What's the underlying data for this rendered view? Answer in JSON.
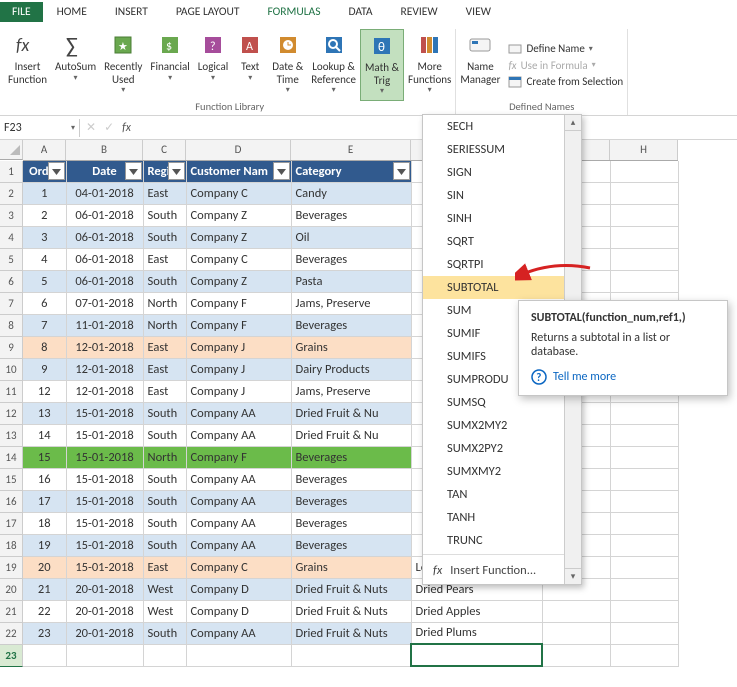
{
  "tabs": {
    "file": "FILE",
    "home": "HOME",
    "insert": "INSERT",
    "page": "PAGE LAYOUT",
    "formulas": "FORMULAS",
    "data": "DATA",
    "review": "REVIEW",
    "view": "VIEW"
  },
  "ribbon": {
    "insert_function": "Insert\nFunction",
    "autosum": "AutoSum",
    "recently": "Recently\nUsed",
    "financial": "Financial",
    "logical": "Logical",
    "text": "Text",
    "datetime": "Date &\nTime",
    "lookup": "Lookup &\nReference",
    "math": "Math &\nTrig",
    "more": "More\nFunctions",
    "group_library": "Function Library",
    "name_mgr": "Name\nManager",
    "def_name": "Define Name",
    "use_formula": "Use in Formula",
    "create_sel": "Create from Selection",
    "group_names": "Defined Names"
  },
  "namebox": "F23",
  "headers": {
    "A": "Order",
    "B": "Date",
    "C": "Regic",
    "D": "Customer Nam",
    "E": "Category"
  },
  "rows": [
    {
      "n": "1",
      "d": "04-01-2018",
      "r": "East",
      "c": "Company C",
      "cat": "Candy",
      "f": "",
      "cls": "band"
    },
    {
      "n": "2",
      "d": "06-01-2018",
      "r": "South",
      "c": "Company Z",
      "cat": "Beverages",
      "f": "",
      "cls": ""
    },
    {
      "n": "3",
      "d": "06-01-2018",
      "r": "South",
      "c": "Company Z",
      "cat": "Oil",
      "f": "",
      "cls": "band"
    },
    {
      "n": "4",
      "d": "06-01-2018",
      "r": "East",
      "c": "Company C",
      "cat": "Beverages",
      "f": "",
      "cls": ""
    },
    {
      "n": "5",
      "d": "06-01-2018",
      "r": "South",
      "c": "Company Z",
      "cat": "Pasta",
      "f": "",
      "cls": "band"
    },
    {
      "n": "6",
      "d": "07-01-2018",
      "r": "North",
      "c": "Company F",
      "cat": "Jams, Preserve",
      "f": "",
      "cls": ""
    },
    {
      "n": "7",
      "d": "11-01-2018",
      "r": "North",
      "c": "Company F",
      "cat": "Beverages",
      "f": "",
      "cls": "band"
    },
    {
      "n": "8",
      "d": "12-01-2018",
      "r": "East",
      "c": "Company J",
      "cat": "Grains",
      "f": "",
      "cls": "orange"
    },
    {
      "n": "9",
      "d": "12-01-2018",
      "r": "East",
      "c": "Company J",
      "cat": "Dairy Products",
      "f": "",
      "cls": "band"
    },
    {
      "n": "12",
      "d": "12-01-2018",
      "r": "East",
      "c": "Company J",
      "cat": "Jams, Preserve",
      "f": "",
      "cls": ""
    },
    {
      "n": "13",
      "d": "15-01-2018",
      "r": "South",
      "c": "Company AA",
      "cat": "Dried Fruit & Nu",
      "f": "",
      "cls": "band"
    },
    {
      "n": "14",
      "d": "15-01-2018",
      "r": "South",
      "c": "Company AA",
      "cat": "Dried Fruit & Nu",
      "f": "",
      "cls": ""
    },
    {
      "n": "15",
      "d": "15-01-2018",
      "r": "North",
      "c": "Company F",
      "cat": "Beverages",
      "f": "",
      "cls": "green"
    },
    {
      "n": "16",
      "d": "15-01-2018",
      "r": "South",
      "c": "Company AA",
      "cat": "Beverages",
      "f": "",
      "cls": ""
    },
    {
      "n": "17",
      "d": "15-01-2018",
      "r": "South",
      "c": "Company AA",
      "cat": "Beverages",
      "f": "",
      "cls": "band"
    },
    {
      "n": "18",
      "d": "15-01-2018",
      "r": "South",
      "c": "Company AA",
      "cat": "Beverages",
      "f": "",
      "cls": ""
    },
    {
      "n": "19",
      "d": "15-01-2018",
      "r": "South",
      "c": "Company AA",
      "cat": "Beverages",
      "f": "",
      "cls": "band"
    },
    {
      "n": "20",
      "d": "15-01-2018",
      "r": "East",
      "c": "Company C",
      "cat": "Grains",
      "f": "Long Grain Rice",
      "cls": "orange"
    },
    {
      "n": "21",
      "d": "20-01-2018",
      "r": "West",
      "c": "Company D",
      "cat": "Dried Fruit & Nuts",
      "f": "Dried Pears",
      "cls": "band"
    },
    {
      "n": "22",
      "d": "20-01-2018",
      "r": "West",
      "c": "Company D",
      "cat": "Dried Fruit & Nuts",
      "f": "Dried Apples",
      "cls": ""
    },
    {
      "n": "23",
      "d": "20-01-2018",
      "r": "South",
      "c": "Company AA",
      "cat": "Dried Fruit & Nuts",
      "f": "Dried Plums",
      "cls": "band"
    }
  ],
  "row_ids": [
    "1",
    "2",
    "3",
    "4",
    "5",
    "6",
    "7",
    "8",
    "9",
    "10",
    "11",
    "12",
    "13",
    "14",
    "15",
    "16",
    "17",
    "18",
    "19",
    "20",
    "21",
    "22",
    "23"
  ],
  "menu": [
    "SECH",
    "SERIESSUM",
    "SIGN",
    "SIN",
    "SINH",
    "SQRT",
    "SQRTPI",
    "SUBTOTAL",
    "SUM",
    "SUMIF",
    "SUMIFS",
    "SUMPRODU",
    "SUMSQ",
    "SUMX2MY2",
    "SUMX2PY2",
    "SUMXMY2",
    "TAN",
    "TANH",
    "TRUNC"
  ],
  "menu_insert": "Insert Function...",
  "tooltip": {
    "title": "SUBTOTAL(function_num,ref1,)",
    "body": "Returns a subtotal in a list or database.",
    "more": "Tell me more"
  }
}
